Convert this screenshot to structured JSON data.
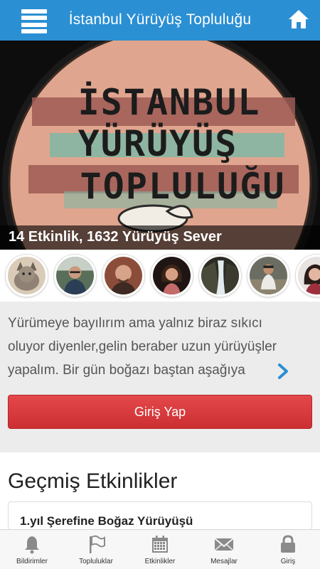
{
  "topbar": {
    "title": "İstanbul Yürüyüş Topluluğu",
    "menu_icon": "hamburger-menu-icon",
    "home_icon": "home-icon"
  },
  "hero": {
    "logo_lines": [
      "İSTANBUL",
      "YÜRÜYÜŞ",
      "TOPLULUĞU"
    ],
    "caption": "14 Etkinlik, 1632 Yürüyüş Sever"
  },
  "members": {
    "avatars": [
      "cat",
      "man-glasses",
      "bald-man",
      "woman",
      "waterfall",
      "hiker",
      "woman-partial"
    ]
  },
  "description": {
    "lines": [
      "Yürümeye bayılırım ama yalnız biraz sıkıcı",
      "oluyor diyenler,gelin beraber uzun yürüyüşler",
      "yapalım. Bir gün boğazı baştan aşağıya"
    ],
    "more_icon": "chevron-right-icon"
  },
  "login_button": "Giriş Yap",
  "past_events": {
    "title": "Geçmiş Etkinlikler",
    "items": [
      {
        "title": "1.yıl Şerefine Boğaz Yürüyüşü"
      }
    ]
  },
  "bottom_nav": {
    "items": [
      {
        "label": "Bildirimler",
        "icon": "bell-icon"
      },
      {
        "label": "Topluluklar",
        "icon": "flag-icon"
      },
      {
        "label": "Etkinlikler",
        "icon": "calendar-icon"
      },
      {
        "label": "Mesajlar",
        "icon": "envelope-icon"
      },
      {
        "label": "Giriş",
        "icon": "lock-icon"
      }
    ]
  },
  "colors": {
    "primary": "#2b8fd3",
    "button": "#d93a3d",
    "background": "#ececec"
  }
}
